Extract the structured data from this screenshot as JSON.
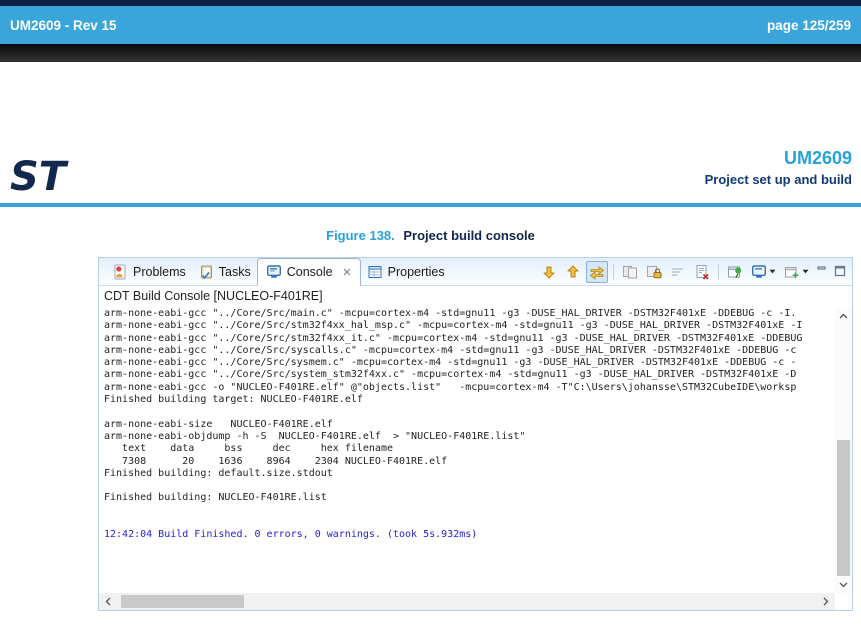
{
  "page_header": {
    "doc_rev": "UM2609 - Rev 15",
    "page_indicator": "page 125/259"
  },
  "doc_header": {
    "logo": "st-logo",
    "title": "UM2609",
    "subtitle": "Project set up and build"
  },
  "figure": {
    "label": "Figure 138.",
    "title": "Project build console"
  },
  "console_view": {
    "tabs": [
      {
        "label": "Problems",
        "icon": "problems-icon",
        "active": false
      },
      {
        "label": "Tasks",
        "icon": "tasks-icon",
        "active": false
      },
      {
        "label": "Console",
        "icon": "console-icon",
        "active": true,
        "closable": true
      },
      {
        "label": "Properties",
        "icon": "properties-icon",
        "active": false
      }
    ],
    "toolbar_icons": [
      "scroll-down-arrow-icon",
      "scroll-up-arrow-icon",
      "show-console-when-output-changes-icon",
      "remove-launch-icon",
      "scroll-lock-icon",
      "word-wrap-icon",
      "clear-console-icon",
      "pin-console-icon",
      "display-selected-console-icon",
      "open-console-icon",
      "minimize-icon",
      "maximize-icon"
    ],
    "title": "CDT Build Console [NUCLEO-F401RE]",
    "lines": [
      {
        "type": "default",
        "text": "arm-none-eabi-gcc \"../Core/Src/main.c\" -mcpu=cortex-m4 -std=gnu11 -g3 -DUSE_HAL_DRIVER -DSTM32F401xE -DDEBUG -c -I."
      },
      {
        "type": "default",
        "text": "arm-none-eabi-gcc \"../Core/Src/stm32f4xx_hal_msp.c\" -mcpu=cortex-m4 -std=gnu11 -g3 -DUSE_HAL_DRIVER -DSTM32F401xE -I"
      },
      {
        "type": "default",
        "text": "arm-none-eabi-gcc \"../Core/Src/stm32f4xx_it.c\" -mcpu=cortex-m4 -std=gnu11 -g3 -DUSE_HAL_DRIVER -DSTM32F401xE -DDEBUG"
      },
      {
        "type": "default",
        "text": "arm-none-eabi-gcc \"../Core/Src/syscalls.c\" -mcpu=cortex-m4 -std=gnu11 -g3 -DUSE_HAL_DRIVER -DSTM32F401xE -DDEBUG -c"
      },
      {
        "type": "default",
        "text": "arm-none-eabi-gcc \"../Core/Src/sysmem.c\" -mcpu=cortex-m4 -std=gnu11 -g3 -DUSE_HAL_DRIVER -DSTM32F401xE -DDEBUG -c -"
      },
      {
        "type": "default",
        "text": "arm-none-eabi-gcc \"../Core/Src/system_stm32f4xx.c\" -mcpu=cortex-m4 -std=gnu11 -g3 -DUSE_HAL_DRIVER -DSTM32F401xE -D"
      },
      {
        "type": "default",
        "text": "arm-none-eabi-gcc -o \"NUCLEO-F401RE.elf\" @\"objects.list\"   -mcpu=cortex-m4 -T\"C:\\Users\\johansse\\STM32CubeIDE\\worksp"
      },
      {
        "type": "default",
        "text": "Finished building target: NUCLEO-F401RE.elf"
      },
      {
        "type": "default",
        "text": ""
      },
      {
        "type": "default",
        "text": "arm-none-eabi-size   NUCLEO-F401RE.elf"
      },
      {
        "type": "default",
        "text": "arm-none-eabi-objdump -h -S  NUCLEO-F401RE.elf  > \"NUCLEO-F401RE.list\""
      },
      {
        "type": "default",
        "text": "   text    data     bss     dec     hex filename"
      },
      {
        "type": "default",
        "text": "   7308      20    1636    8964    2304 NUCLEO-F401RE.elf"
      },
      {
        "type": "default",
        "text": "Finished building: default.size.stdout"
      },
      {
        "type": "default",
        "text": ""
      },
      {
        "type": "default",
        "text": "Finished building: NUCLEO-F401RE.list"
      },
      {
        "type": "default",
        "text": ""
      },
      {
        "type": "default",
        "text": ""
      },
      {
        "type": "info",
        "text": "12:42:04 Build Finished. 0 errors, 0 warnings. (took 5s.932ms)"
      }
    ]
  },
  "colors": {
    "banner_blue": "#3aa5da",
    "navy": "#0c2142",
    "heading_blue": "#28a2db",
    "subtitle_navy": "#123a77",
    "console_info_blue": "#2323cf",
    "toolbar_arrow_yellow": "#f0c040"
  }
}
